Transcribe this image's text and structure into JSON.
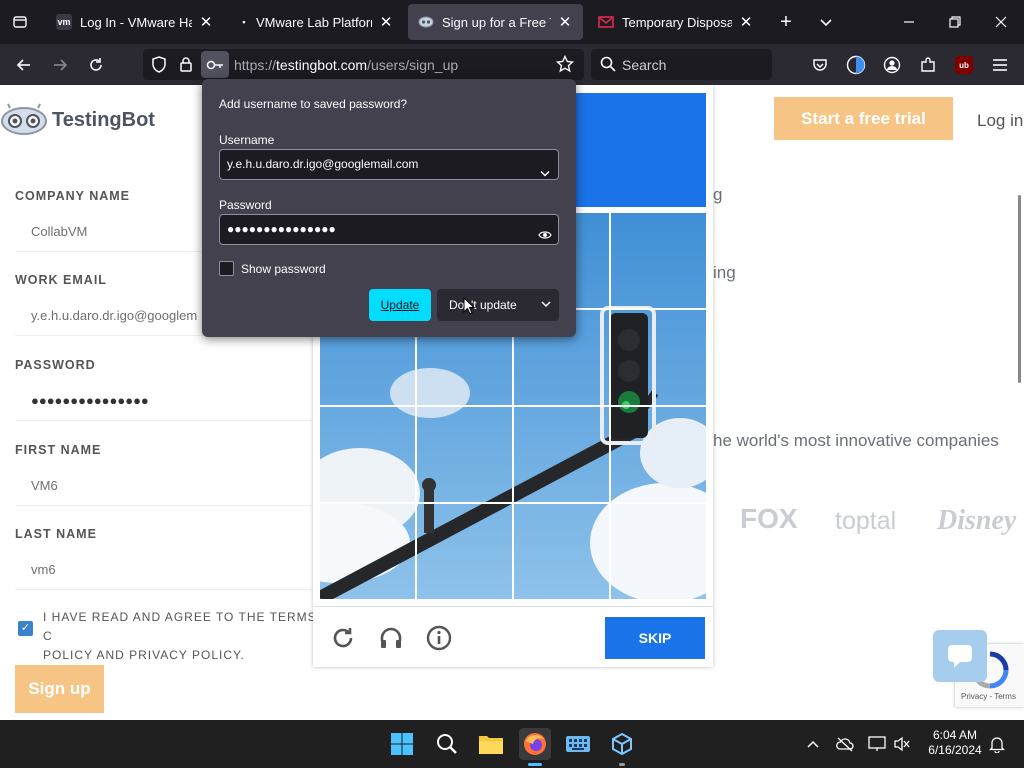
{
  "browser": {
    "tabs": [
      {
        "favicon": "vm",
        "title": "Log In - VMware Handi",
        "close": "✕"
      },
      {
        "favicon": "•",
        "title": "VMware Lab Platform",
        "close": "✕"
      },
      {
        "favicon": "",
        "title": "Sign up for a Free Testi",
        "close": "✕"
      },
      {
        "favicon": "",
        "title": "Temporary Disposable",
        "close": "✕"
      }
    ],
    "new_tab": "+",
    "url_prefix": "https://",
    "url_host": "testingbot.com",
    "url_path": "/users/sign_up",
    "search_placeholder": "Search",
    "extension_badge": "ub"
  },
  "site": {
    "brand": "TestingBot",
    "cta": "Start a free trial",
    "login": "Log in"
  },
  "form": {
    "company_label": "COMPANY NAME",
    "company_value": "CollabVM",
    "email_label": "WORK EMAIL",
    "email_value": "y.e.h.u.daro.dr.igo@googlem",
    "password_label": "PASSWORD",
    "password_value": "●●●●●●●●●●●●●●●",
    "first_label": "FIRST NAME",
    "first_value": "VM6",
    "last_label": "LAST NAME",
    "last_value": "vm6",
    "agree_line1": "I HAVE READ AND AGREE TO THE TERMS C",
    "agree_line2": "POLICY AND PRIVACY POLICY.",
    "submit": "Sign up"
  },
  "right": {
    "line1": "g",
    "line2": "ing",
    "companies": "he world's most innovative companies",
    "brands": [
      "FOX",
      "toptal",
      "Disney"
    ]
  },
  "captcha": {
    "skip": "SKIP"
  },
  "password_prompt": {
    "title": "Add username to saved password?",
    "username_label": "Username",
    "username_value": "y.e.h.u.daro.dr.igo@googlemail.com",
    "password_label": "Password",
    "password_value": "●●●●●●●●●●●●●●●",
    "show_password": "Show password",
    "update": "Update",
    "dont_update": "Don't update"
  },
  "recaptcha": {
    "text": "Privacy - Terms"
  },
  "taskbar": {
    "time": "6:04 AM",
    "date": "6/16/2024"
  },
  "colors": {
    "accent": "#00ddff",
    "captcha_blue": "#1a73e8",
    "cta": "#f6c485"
  }
}
